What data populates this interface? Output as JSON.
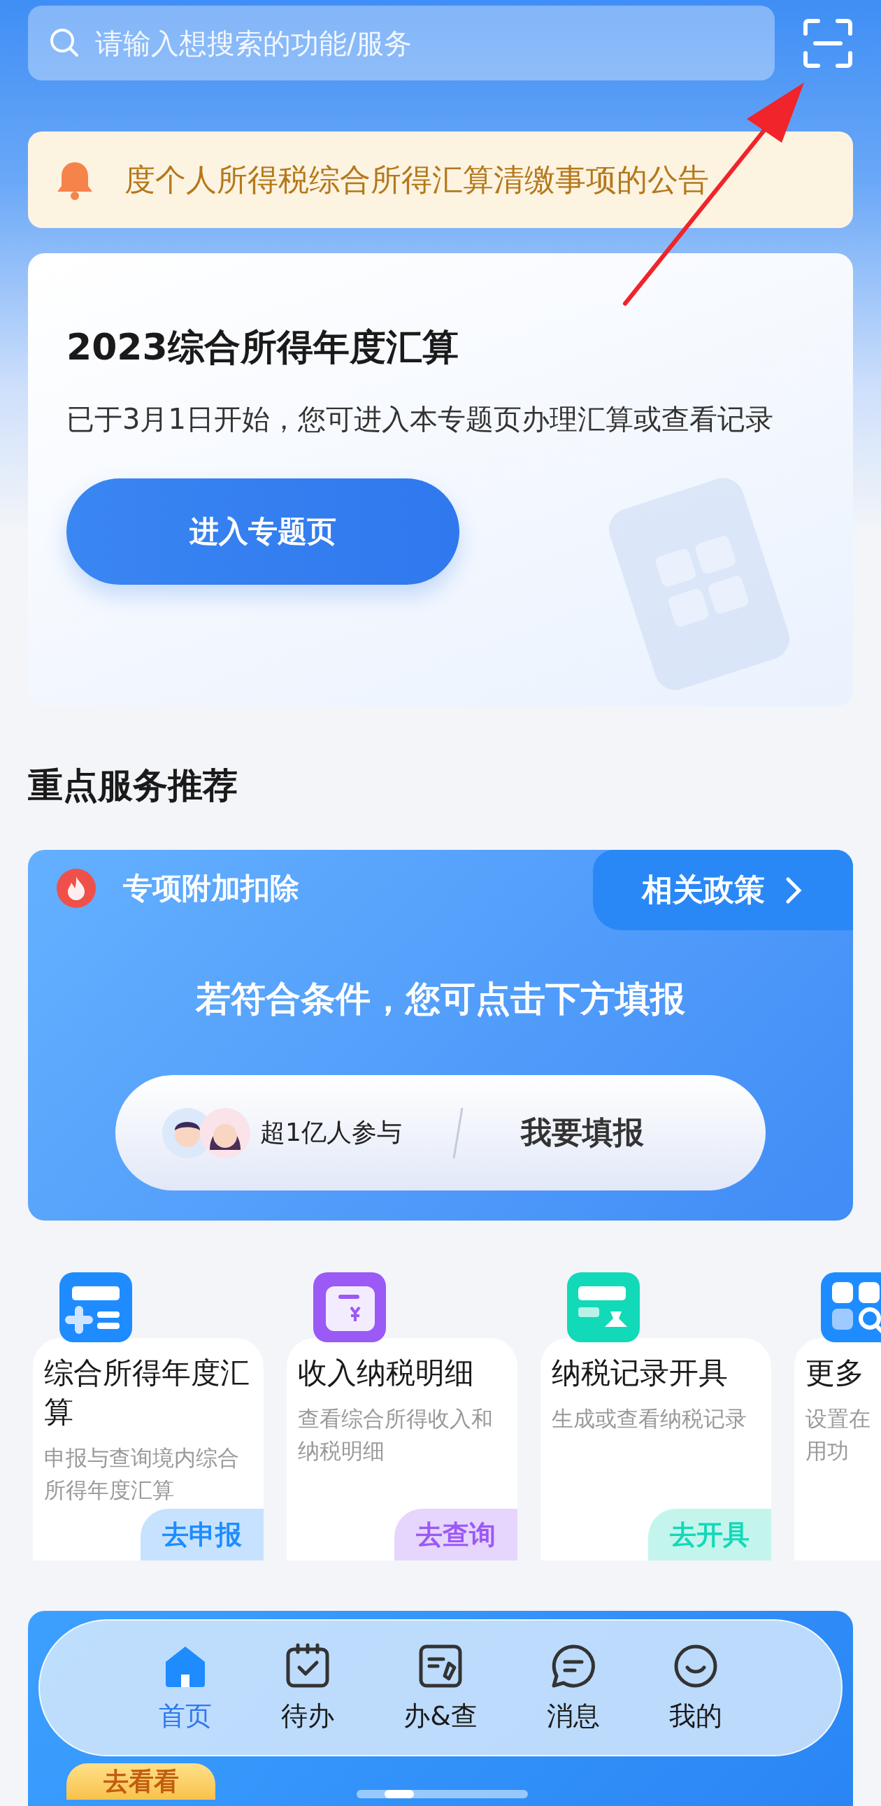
{
  "search": {
    "placeholder": "请输入想搜索的功能/服务"
  },
  "notice": {
    "text": "度个人所得税综合所得汇算清缴事项的公告"
  },
  "hero": {
    "title": "2023综合所得年度汇算",
    "description": "已于3月1日开始，您可进入本专题页办理汇算或查看记录",
    "button": "进入专题页"
  },
  "section_title": "重点服务推荐",
  "feature_card": {
    "title": "专项附加扣除",
    "link": "相关政策",
    "headline": "若符合条件，您可点击下方填报",
    "participants": "超1亿人参与",
    "action": "我要填报"
  },
  "services": [
    {
      "kind": "form",
      "title": "综合所得年度汇算",
      "description": "申报与查询境内综合所得年度汇算",
      "action": "去申报",
      "color": "#1e8cff"
    },
    {
      "kind": "wallet",
      "title": "收入纳税明细",
      "description": "查看综合所得收入和纳税明细",
      "action": "去查询",
      "color": "#9b59f6"
    },
    {
      "kind": "certificate",
      "title": "纳税记录开具",
      "description": "生成或查看纳税记录",
      "action": "去开具",
      "color": "#12d9b8"
    },
    {
      "kind": "grid",
      "title": "更多",
      "description": "设置在用功"
    }
  ],
  "banner": {
    "button": "去看看"
  },
  "tabs": [
    {
      "kind": "home",
      "label": "首页",
      "selected": true
    },
    {
      "kind": "calendar",
      "label": "待办",
      "selected": false
    },
    {
      "kind": "document",
      "label": "办&查",
      "selected": false
    },
    {
      "kind": "message",
      "label": "消息",
      "selected": false
    },
    {
      "kind": "smile",
      "label": "我的",
      "selected": false
    }
  ]
}
